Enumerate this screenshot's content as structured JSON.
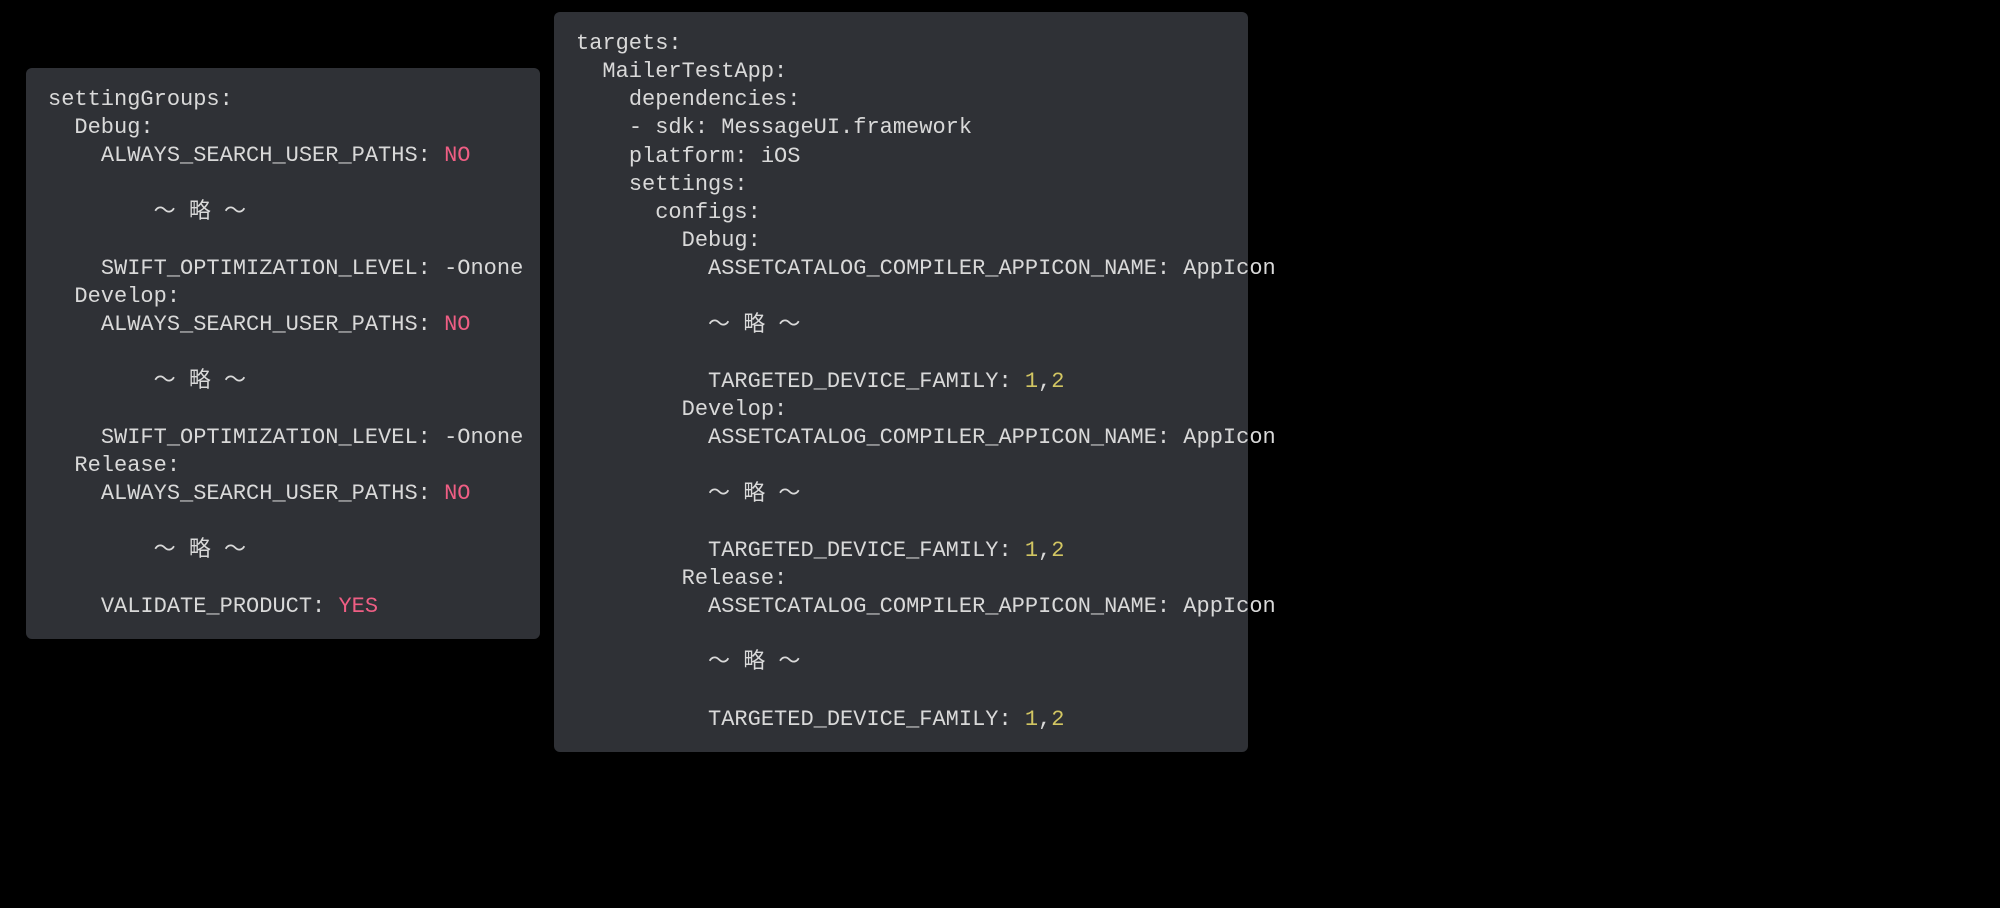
{
  "left": {
    "lines": [
      {
        "indent": 0,
        "segments": [
          {
            "text": "settingGroups:",
            "cls": "kw"
          }
        ]
      },
      {
        "indent": 1,
        "segments": [
          {
            "text": "Debug:",
            "cls": "kw"
          }
        ]
      },
      {
        "indent": 2,
        "segments": [
          {
            "text": "ALWAYS_SEARCH_USER_PATHS: ",
            "cls": "kw"
          },
          {
            "text": "NO",
            "cls": "val-bool"
          }
        ]
      },
      {
        "indent": 0,
        "segments": [
          {
            "text": "",
            "cls": "kw"
          }
        ]
      },
      {
        "indent": 4,
        "segments": [
          {
            "text": "〜 略 〜",
            "cls": "omit"
          }
        ]
      },
      {
        "indent": 0,
        "segments": [
          {
            "text": "",
            "cls": "kw"
          }
        ]
      },
      {
        "indent": 2,
        "segments": [
          {
            "text": "SWIFT_OPTIMIZATION_LEVEL: -Onone",
            "cls": "kw"
          }
        ]
      },
      {
        "indent": 1,
        "segments": [
          {
            "text": "Develop:",
            "cls": "kw"
          }
        ]
      },
      {
        "indent": 2,
        "segments": [
          {
            "text": "ALWAYS_SEARCH_USER_PATHS: ",
            "cls": "kw"
          },
          {
            "text": "NO",
            "cls": "val-bool"
          }
        ]
      },
      {
        "indent": 0,
        "segments": [
          {
            "text": "",
            "cls": "kw"
          }
        ]
      },
      {
        "indent": 4,
        "segments": [
          {
            "text": "〜 略 〜",
            "cls": "omit"
          }
        ]
      },
      {
        "indent": 0,
        "segments": [
          {
            "text": "",
            "cls": "kw"
          }
        ]
      },
      {
        "indent": 2,
        "segments": [
          {
            "text": "SWIFT_OPTIMIZATION_LEVEL: -Onone",
            "cls": "kw"
          }
        ]
      },
      {
        "indent": 1,
        "segments": [
          {
            "text": "Release:",
            "cls": "kw"
          }
        ]
      },
      {
        "indent": 2,
        "segments": [
          {
            "text": "ALWAYS_SEARCH_USER_PATHS: ",
            "cls": "kw"
          },
          {
            "text": "NO",
            "cls": "val-bool"
          }
        ]
      },
      {
        "indent": 0,
        "segments": [
          {
            "text": "",
            "cls": "kw"
          }
        ]
      },
      {
        "indent": 4,
        "segments": [
          {
            "text": "〜 略 〜",
            "cls": "omit"
          }
        ]
      },
      {
        "indent": 0,
        "segments": [
          {
            "text": "",
            "cls": "kw"
          }
        ]
      },
      {
        "indent": 2,
        "segments": [
          {
            "text": "VALIDATE_PRODUCT: ",
            "cls": "kw"
          },
          {
            "text": "YES",
            "cls": "val-bool"
          }
        ]
      }
    ]
  },
  "right": {
    "lines": [
      {
        "indent": 0,
        "segments": [
          {
            "text": "targets:",
            "cls": "kw"
          }
        ]
      },
      {
        "indent": 1,
        "segments": [
          {
            "text": "MailerTestApp:",
            "cls": "kw"
          }
        ]
      },
      {
        "indent": 2,
        "segments": [
          {
            "text": "dependencies:",
            "cls": "kw"
          }
        ]
      },
      {
        "indent": 2,
        "segments": [
          {
            "text": "- sdk: MessageUI.framework",
            "cls": "kw"
          }
        ]
      },
      {
        "indent": 2,
        "segments": [
          {
            "text": "platform: iOS",
            "cls": "kw"
          }
        ]
      },
      {
        "indent": 2,
        "segments": [
          {
            "text": "settings:",
            "cls": "kw"
          }
        ]
      },
      {
        "indent": 3,
        "segments": [
          {
            "text": "configs:",
            "cls": "kw"
          }
        ]
      },
      {
        "indent": 4,
        "segments": [
          {
            "text": "Debug:",
            "cls": "kw"
          }
        ]
      },
      {
        "indent": 5,
        "segments": [
          {
            "text": "ASSETCATALOG_COMPILER_APPICON_NAME: AppIcon",
            "cls": "kw"
          }
        ]
      },
      {
        "indent": 0,
        "segments": [
          {
            "text": "",
            "cls": "kw"
          }
        ]
      },
      {
        "indent": 5,
        "segments": [
          {
            "text": "〜 略 〜",
            "cls": "omit"
          }
        ]
      },
      {
        "indent": 0,
        "segments": [
          {
            "text": "",
            "cls": "kw"
          }
        ]
      },
      {
        "indent": 5,
        "segments": [
          {
            "text": "TARGETED_DEVICE_FAMILY: ",
            "cls": "kw"
          },
          {
            "text": "1",
            "cls": "val-num"
          },
          {
            "text": ",",
            "cls": "kw"
          },
          {
            "text": "2",
            "cls": "val-num"
          }
        ]
      },
      {
        "indent": 4,
        "segments": [
          {
            "text": "Develop:",
            "cls": "kw"
          }
        ]
      },
      {
        "indent": 5,
        "segments": [
          {
            "text": "ASSETCATALOG_COMPILER_APPICON_NAME: AppIcon",
            "cls": "kw"
          }
        ]
      },
      {
        "indent": 0,
        "segments": [
          {
            "text": "",
            "cls": "kw"
          }
        ]
      },
      {
        "indent": 5,
        "segments": [
          {
            "text": "〜 略 〜",
            "cls": "omit"
          }
        ]
      },
      {
        "indent": 0,
        "segments": [
          {
            "text": "",
            "cls": "kw"
          }
        ]
      },
      {
        "indent": 5,
        "segments": [
          {
            "text": "TARGETED_DEVICE_FAMILY: ",
            "cls": "kw"
          },
          {
            "text": "1",
            "cls": "val-num"
          },
          {
            "text": ",",
            "cls": "kw"
          },
          {
            "text": "2",
            "cls": "val-num"
          }
        ]
      },
      {
        "indent": 4,
        "segments": [
          {
            "text": "Release:",
            "cls": "kw"
          }
        ]
      },
      {
        "indent": 5,
        "segments": [
          {
            "text": "ASSETCATALOG_COMPILER_APPICON_NAME: AppIcon",
            "cls": "kw"
          }
        ]
      },
      {
        "indent": 0,
        "segments": [
          {
            "text": "",
            "cls": "kw"
          }
        ]
      },
      {
        "indent": 5,
        "segments": [
          {
            "text": "〜 略 〜",
            "cls": "omit"
          }
        ]
      },
      {
        "indent": 0,
        "segments": [
          {
            "text": "",
            "cls": "kw"
          }
        ]
      },
      {
        "indent": 5,
        "segments": [
          {
            "text": "TARGETED_DEVICE_FAMILY: ",
            "cls": "kw"
          },
          {
            "text": "1",
            "cls": "val-num"
          },
          {
            "text": ",",
            "cls": "kw"
          },
          {
            "text": "2",
            "cls": "val-num"
          }
        ]
      }
    ]
  },
  "indent_unit": "  "
}
